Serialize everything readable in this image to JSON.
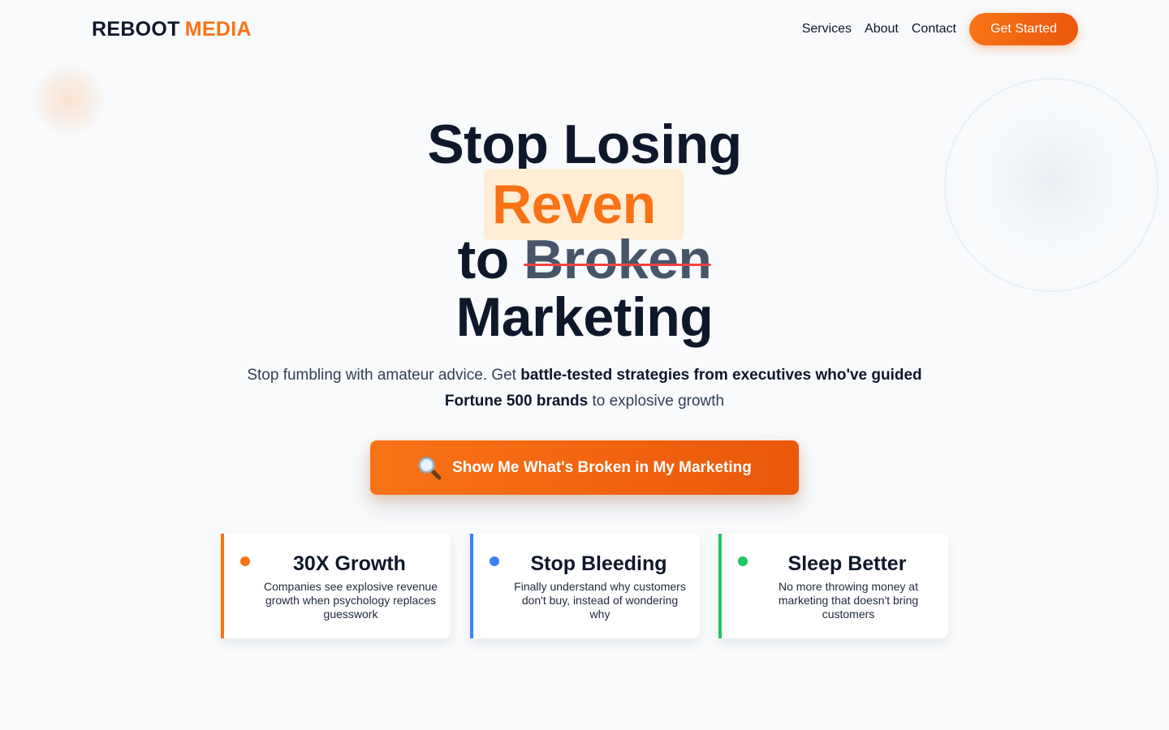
{
  "brand": {
    "word1": "REBOOT",
    "word2": "MEDIA",
    "accent_color": "#f97316"
  },
  "nav": {
    "links": [
      "Services",
      "About",
      "Contact"
    ],
    "cta_label": "Get Started"
  },
  "hero": {
    "line1": "Stop Losing",
    "highlight": "Reven",
    "line3_prefix": "to",
    "line3_struck": "Broken",
    "line4": "Marketing"
  },
  "subtitle": {
    "part1": "Stop fumbling with amateur advice. Get ",
    "bold1": "battle-tested strategies from executives who've guided Fortune 500 brands",
    "part2": " to explosive growth"
  },
  "cta": {
    "icon": "magnifying-glass-icon",
    "label": "Show Me What's Broken in My Marketing"
  },
  "features": [
    {
      "title": "30X Growth",
      "text": "Companies see explosive revenue growth when psychology replaces guesswork",
      "color": "#f97316"
    },
    {
      "title": "Stop Bleeding",
      "text": "Finally understand why customers don't buy, instead of wondering why",
      "color": "#3b82f6"
    },
    {
      "title": "Sleep Better",
      "text": "No more throwing money at marketing that doesn't bring customers",
      "color": "#22c55e"
    }
  ]
}
